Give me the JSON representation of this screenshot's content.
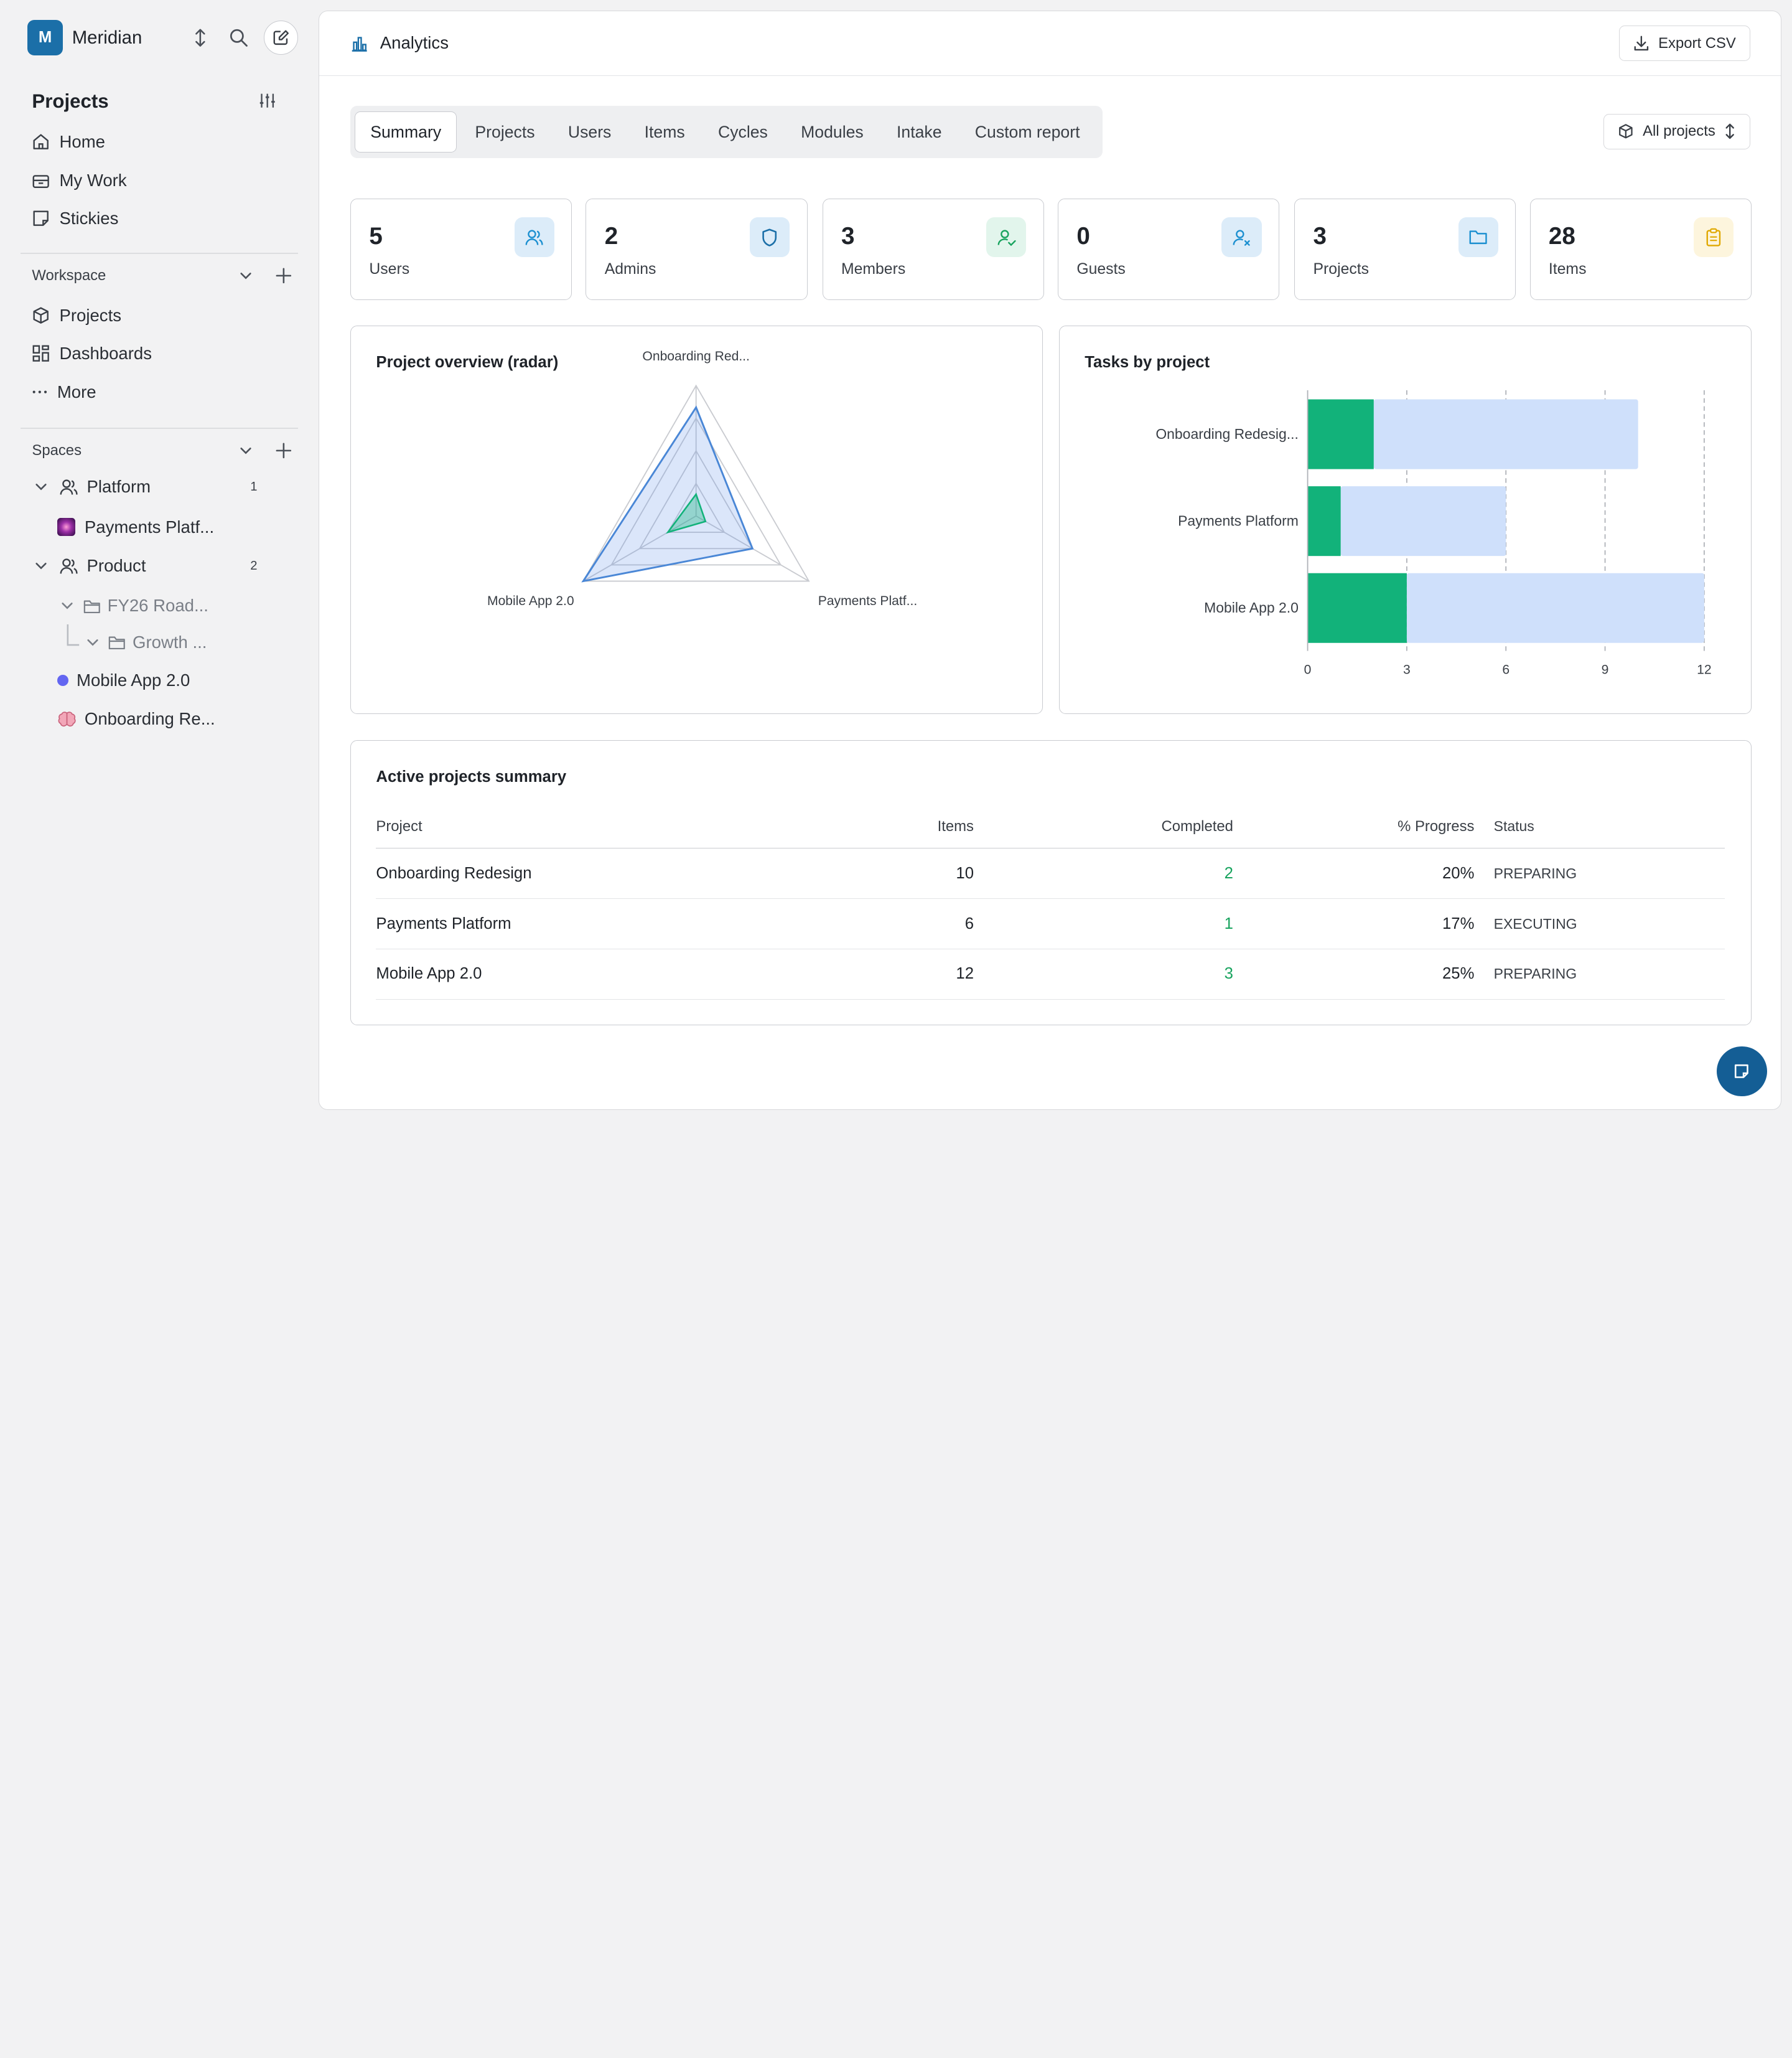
{
  "workspace": {
    "initial": "M",
    "name": "Meridian"
  },
  "sidebar": {
    "title": "Projects",
    "nav": [
      {
        "label": "Home",
        "icon": "home-icon"
      },
      {
        "label": "My Work",
        "icon": "briefcase-icon"
      },
      {
        "label": "Stickies",
        "icon": "sticky-note-icon"
      }
    ],
    "workspace_section": {
      "label": "Workspace",
      "items": [
        {
          "label": "Projects",
          "icon": "box-icon"
        },
        {
          "label": "Dashboards",
          "icon": "dashboard-icon"
        },
        {
          "label": "More",
          "icon": "ellipsis-icon"
        }
      ]
    },
    "spaces": {
      "label": "Spaces",
      "tree": [
        {
          "label": "Platform",
          "count": "1"
        },
        {
          "label": "Payments Platf..."
        },
        {
          "label": "Product",
          "count": "2"
        },
        {
          "label": "FY26 Road..."
        },
        {
          "label": "Growth ..."
        },
        {
          "label": "Mobile App 2.0"
        },
        {
          "label": "Onboarding Re..."
        }
      ]
    }
  },
  "header": {
    "title": "Analytics",
    "export_label": "Export CSV"
  },
  "tabs": [
    "Summary",
    "Projects",
    "Users",
    "Items",
    "Cycles",
    "Modules",
    "Intake",
    "Custom report"
  ],
  "active_tab": "Summary",
  "project_filter": "All projects",
  "stats": [
    {
      "value": "5",
      "label": "Users",
      "icon": "users-icon",
      "color": "#1b8fd0"
    },
    {
      "value": "2",
      "label": "Admins",
      "icon": "shield-icon",
      "color": "#1b6fa8"
    },
    {
      "value": "3",
      "label": "Members",
      "icon": "user-check-icon",
      "color": "#18a35e"
    },
    {
      "value": "0",
      "label": "Guests",
      "icon": "user-x-icon",
      "color": "#1b8fd0"
    },
    {
      "value": "3",
      "label": "Projects",
      "icon": "folder-icon",
      "color": "#1b8fd0"
    },
    {
      "value": "28",
      "label": "Items",
      "icon": "clipboard-icon",
      "color": "#e0a800"
    }
  ],
  "radar": {
    "title": "Project overview (radar)",
    "axes": [
      "Onboarding Red...",
      "Payments Platf...",
      "Mobile App 2.0"
    ],
    "items": [
      10,
      6,
      12
    ],
    "completed": [
      2,
      1,
      3
    ],
    "max": 12
  },
  "chart_data": {
    "type": "bar",
    "title": "Tasks by project",
    "categories": [
      "Onboarding Redesig...",
      "Payments Platform",
      "Mobile App 2.0"
    ],
    "series": [
      {
        "values": [
          2,
          1,
          3
        ],
        "color": "#12b27a"
      },
      {
        "values": [
          10,
          6,
          12
        ],
        "color": "#cfe0fb"
      }
    ],
    "xlim": [
      0,
      12
    ],
    "x_ticks": [
      "0",
      "3",
      "6",
      "9",
      "12"
    ]
  },
  "table": {
    "title": "Active projects summary",
    "columns": [
      "Project",
      "Items",
      "Completed",
      "% Progress",
      "Status"
    ],
    "rows": [
      {
        "project": "Onboarding Redesign",
        "items": "10",
        "completed": "2",
        "progress": "20%",
        "status": "PREPARING"
      },
      {
        "project": "Payments Platform",
        "items": "6",
        "completed": "1",
        "progress": "17%",
        "status": "EXECUTING"
      },
      {
        "project": "Mobile App 2.0",
        "items": "12",
        "completed": "3",
        "progress": "25%",
        "status": "PREPARING"
      }
    ]
  }
}
